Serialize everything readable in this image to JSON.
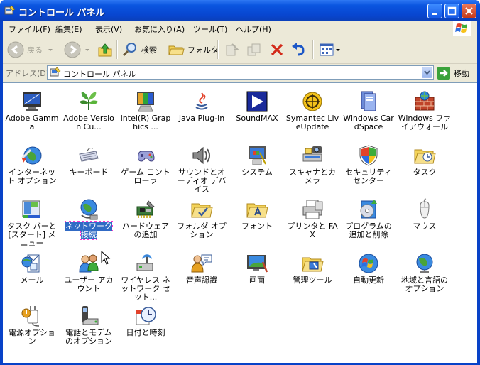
{
  "window": {
    "title": "コントロール パネル"
  },
  "menu": [
    "ファイル(F)",
    "編集(E)",
    "表示(V)",
    "お気に入り(A)",
    "ツール(T)",
    "ヘルプ(H)"
  ],
  "toolbar": {
    "back": "戻る",
    "search": "検索",
    "folder": "フォルダ"
  },
  "address": {
    "label": "アドレス(D)",
    "value": "コントロール パネル",
    "go": "移動"
  },
  "items": [
    {
      "label": "Adobe Gamma",
      "icon": "monitor-icon"
    },
    {
      "label": "Adobe Version Cu...",
      "icon": "leaf-icon"
    },
    {
      "label": "Intel(R) Graphics ...",
      "icon": "graphics-icon"
    },
    {
      "label": "Java Plug-in",
      "icon": "java-icon"
    },
    {
      "label": "SoundMAX",
      "icon": "play-icon"
    },
    {
      "label": "Symantec LiveUpdate",
      "icon": "liveupdate-icon"
    },
    {
      "label": "Windows CardSpace",
      "icon": "cardspace-icon"
    },
    {
      "label": "Windows ファイアウォール",
      "icon": "firewall-icon"
    },
    {
      "label": "インターネット オプション",
      "icon": "internet-icon"
    },
    {
      "label": "キーボード",
      "icon": "keyboard-icon"
    },
    {
      "label": "ゲーム コントローラ",
      "icon": "gamepad-icon"
    },
    {
      "label": "サウンドとオーディオ デバイス",
      "icon": "speaker-icon"
    },
    {
      "label": "システム",
      "icon": "system-icon"
    },
    {
      "label": "スキャナとカメラ",
      "icon": "scanner-icon"
    },
    {
      "label": "セキュリティ センター",
      "icon": "shield-icon"
    },
    {
      "label": "タスク",
      "icon": "task-folder-icon"
    },
    {
      "label": "タスク バーと [スタート] メニュー",
      "icon": "taskbar-icon"
    },
    {
      "label": "ネットワーク接続",
      "icon": "network-icon"
    },
    {
      "label": "ハードウェアの追加",
      "icon": "hardware-icon"
    },
    {
      "label": "フォルダ オプション",
      "icon": "folder-options-icon"
    },
    {
      "label": "フォント",
      "icon": "fonts-folder-icon"
    },
    {
      "label": "プリンタと FAX",
      "icon": "printer-icon"
    },
    {
      "label": "プログラムの追加と削除",
      "icon": "programs-icon"
    },
    {
      "label": "マウス",
      "icon": "mouse-icon"
    },
    {
      "label": "メール",
      "icon": "mail-icon"
    },
    {
      "label": "ユーザー アカウント",
      "icon": "users-icon"
    },
    {
      "label": "ワイヤレス ネットワーク セット...",
      "icon": "wireless-icon"
    },
    {
      "label": "音声認識",
      "icon": "speech-icon"
    },
    {
      "label": "画面",
      "icon": "display-icon"
    },
    {
      "label": "管理ツール",
      "icon": "admin-tools-icon"
    },
    {
      "label": "自動更新",
      "icon": "windows-update-icon"
    },
    {
      "label": "地域と言語のオプション",
      "icon": "globe-icon"
    },
    {
      "label": "電源オプション",
      "icon": "power-icon"
    },
    {
      "label": "電話とモデムのオプション",
      "icon": "phone-icon"
    },
    {
      "label": "日付と時刻",
      "icon": "clock-icon"
    }
  ],
  "selected_item": "ネットワーク接続"
}
